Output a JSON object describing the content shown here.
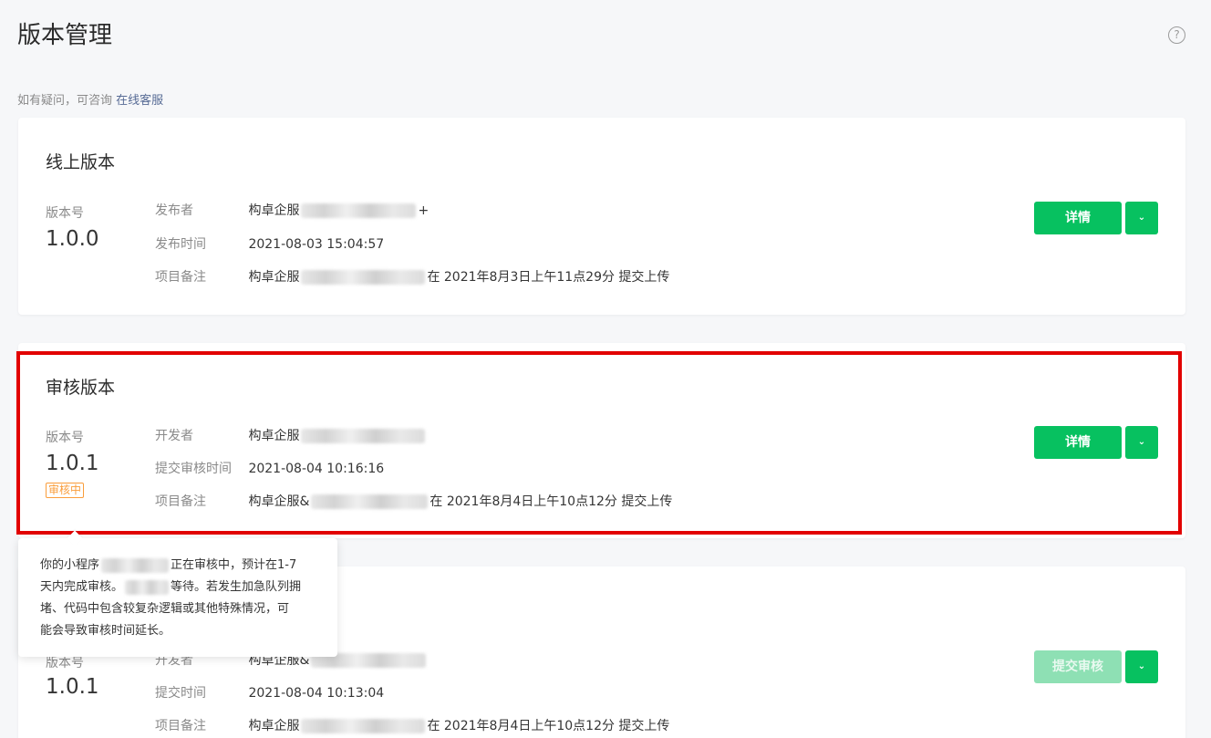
{
  "header": {
    "title": "版本管理",
    "help_icon": "?"
  },
  "hint": {
    "text": "如有疑问，可咨询",
    "link": "在线客服"
  },
  "online": {
    "title": "线上版本",
    "version_label": "版本号",
    "version": "1.0.0",
    "publisher_label": "发布者",
    "publisher_prefix": "构卓企服",
    "publisher_suffix": "+",
    "time_label": "发布时间",
    "time": "2021-08-03 15:04:57",
    "note_label": "项目备注",
    "note_prefix": "构卓企服",
    "note_suffix": "在 2021年8月3日上午11点29分 提交上传",
    "detail_button": "详情",
    "caret": "⌄"
  },
  "review": {
    "title": "审核版本",
    "version_label": "版本号",
    "version": "1.0.1",
    "status_badge": "审核中",
    "developer_label": "开发者",
    "developer_prefix": "构卓企服",
    "time_label": "提交审核时间",
    "time": "2021-08-04 10:16:16",
    "note_label": "项目备注",
    "note_prefix": "构卓企服&",
    "note_suffix": "在 2021年8月4日上午10点12分 提交上传",
    "detail_button": "详情",
    "caret": "⌄"
  },
  "tooltip": {
    "line1_prefix": "你的小程序",
    "line1_suffix": "正在审核中，预计在1-7",
    "line2_prefix": "天内完成审核。",
    "line2_suffix": "等待。若发生加急队列拥",
    "line3": "堵、代码中包含较复杂逻辑或其他特殊情况，可",
    "line4": "能会导致审核时间延长。"
  },
  "dev": {
    "version_label": "版本号",
    "version": "1.0.1",
    "developer_label": "开发者",
    "developer_prefix": "构卓企服&",
    "time_label": "提交时间",
    "time": "2021-08-04 10:13:04",
    "note_label": "项目备注",
    "note_prefix": "构卓企服",
    "note_suffix": "在 2021年8月4日上午10点12分 提交上传",
    "submit_button": "提交审核",
    "caret": "⌄"
  },
  "colors": {
    "primary_green": "#07c160",
    "disabled_green": "#8ee0b4",
    "highlight_red": "#e20000",
    "badge_orange": "#fa9d3b",
    "link_blue": "#576b95"
  }
}
